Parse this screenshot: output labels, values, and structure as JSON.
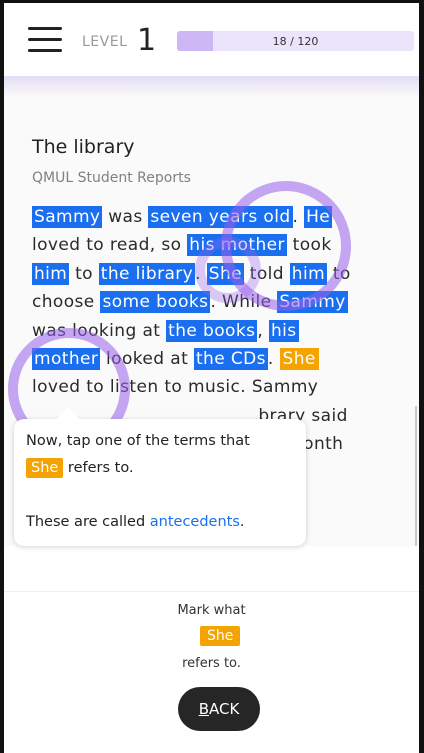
{
  "header": {
    "level_label": "LEVEL",
    "level_number": "1",
    "progress_text": "18 / 120",
    "progress_fraction": 0.15
  },
  "story": {
    "title": "The library",
    "subtitle": "QMUL Student Reports"
  },
  "passage": {
    "lines": [
      [
        {
          "t": "Sammy",
          "h": "blue"
        },
        {
          "t": " was "
        },
        {
          "t": "seven years old",
          "h": "blue"
        },
        {
          "t": ". "
        },
        {
          "t": "He",
          "h": "blue"
        }
      ],
      [
        {
          "t": "loved to read, so "
        },
        {
          "t": "his mother",
          "h": "blue"
        },
        {
          "t": " took"
        }
      ],
      [
        {
          "t": "him",
          "h": "blue"
        },
        {
          "t": " to "
        },
        {
          "t": "the library",
          "h": "blue"
        },
        {
          "t": ". "
        },
        {
          "t": "She",
          "h": "blue"
        },
        {
          "t": " told "
        },
        {
          "t": "him",
          "h": "blue"
        },
        {
          "t": " to"
        }
      ],
      [
        {
          "t": "choose "
        },
        {
          "t": "some books",
          "h": "blue"
        },
        {
          "t": ". While "
        },
        {
          "t": "Sammy",
          "h": "blue"
        }
      ],
      [
        {
          "t": "was looking at "
        },
        {
          "t": "the books",
          "h": "blue"
        },
        {
          "t": ", "
        },
        {
          "t": "his",
          "h": "blue"
        }
      ],
      [
        {
          "t": "mother",
          "h": "blue"
        },
        {
          "t": " looked at "
        },
        {
          "t": "the CDs",
          "h": "blue"
        },
        {
          "t": ". "
        },
        {
          "t": "She",
          "h": "orange"
        }
      ],
      [
        {
          "t": "loved to listen to music. Sammy"
        }
      ],
      [
        {
          "t": "                                       brary said"
        }
      ],
      [
        {
          "t": "                                       ne month"
        }
      ]
    ]
  },
  "tooltip": {
    "line1": "Now, tap one of the terms that",
    "badge": "She",
    "line2_suffix": " refers to.",
    "line3_prefix": "These are called ",
    "line3_link": "antecedents",
    "line3_suffix": "."
  },
  "bottom": {
    "mark_line1": "Mark what",
    "mark_badge": "She",
    "mark_line2": "refers to.",
    "back_underlined": "B",
    "back_rest": "ACK"
  },
  "colors": {
    "highlight_blue": "#1a6ff0",
    "highlight_orange": "#f5a300",
    "accent_purple": "#9660eb"
  }
}
